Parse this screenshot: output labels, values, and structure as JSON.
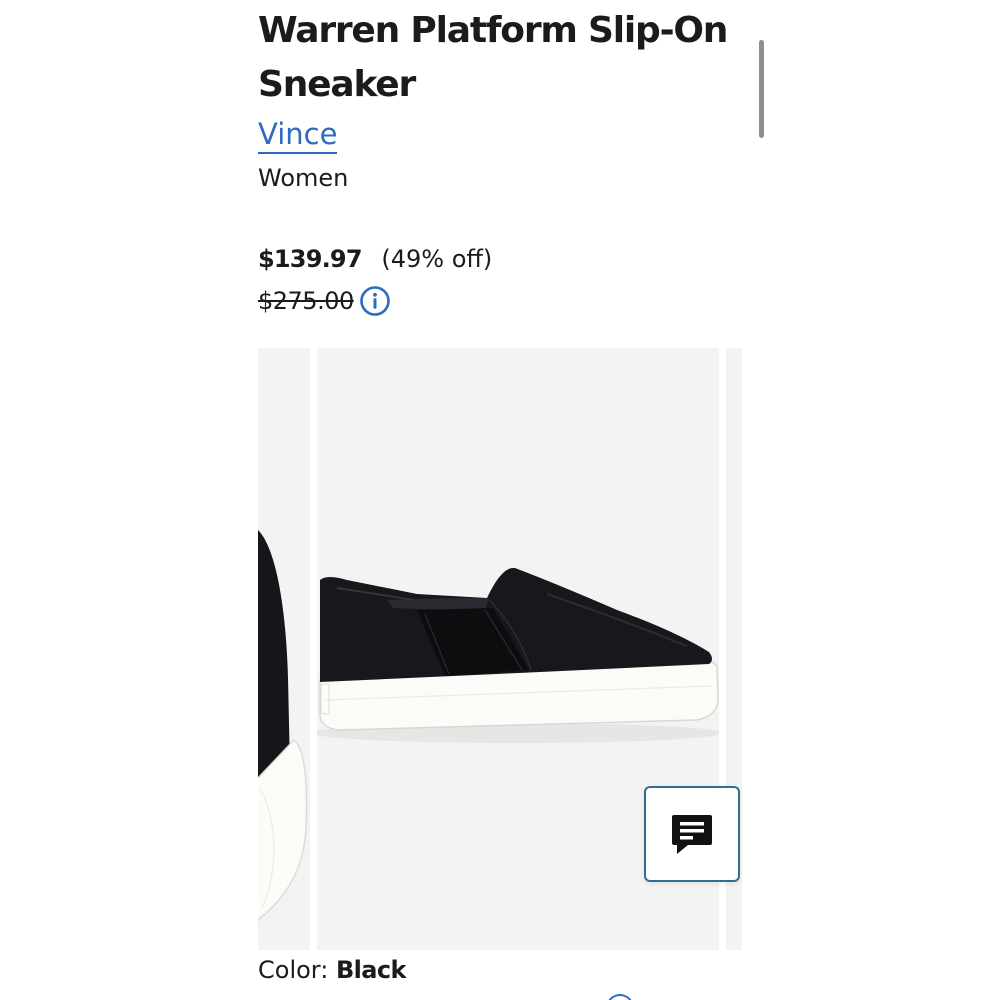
{
  "product": {
    "title": "Warren Platform Slip-On Sneaker",
    "brand": "Vince",
    "category": "Women"
  },
  "pricing": {
    "sale_price": "$139.97",
    "discount": "(49% off)",
    "original_price": "$275.00",
    "info_icon": "info-circle-icon"
  },
  "gallery": {
    "main_image": "black slip-on platform sneaker, side view",
    "prev_image": "black slip-on platform sneaker, close-up of heel",
    "background": "#f3f3f3"
  },
  "color": {
    "label": "Color:",
    "value": "Black"
  },
  "chat": {
    "icon": "chat-message-icon"
  },
  "colors": {
    "text": "#1b1b1b",
    "link": "#2e6bbf",
    "chat_border": "#2f6f8f"
  }
}
